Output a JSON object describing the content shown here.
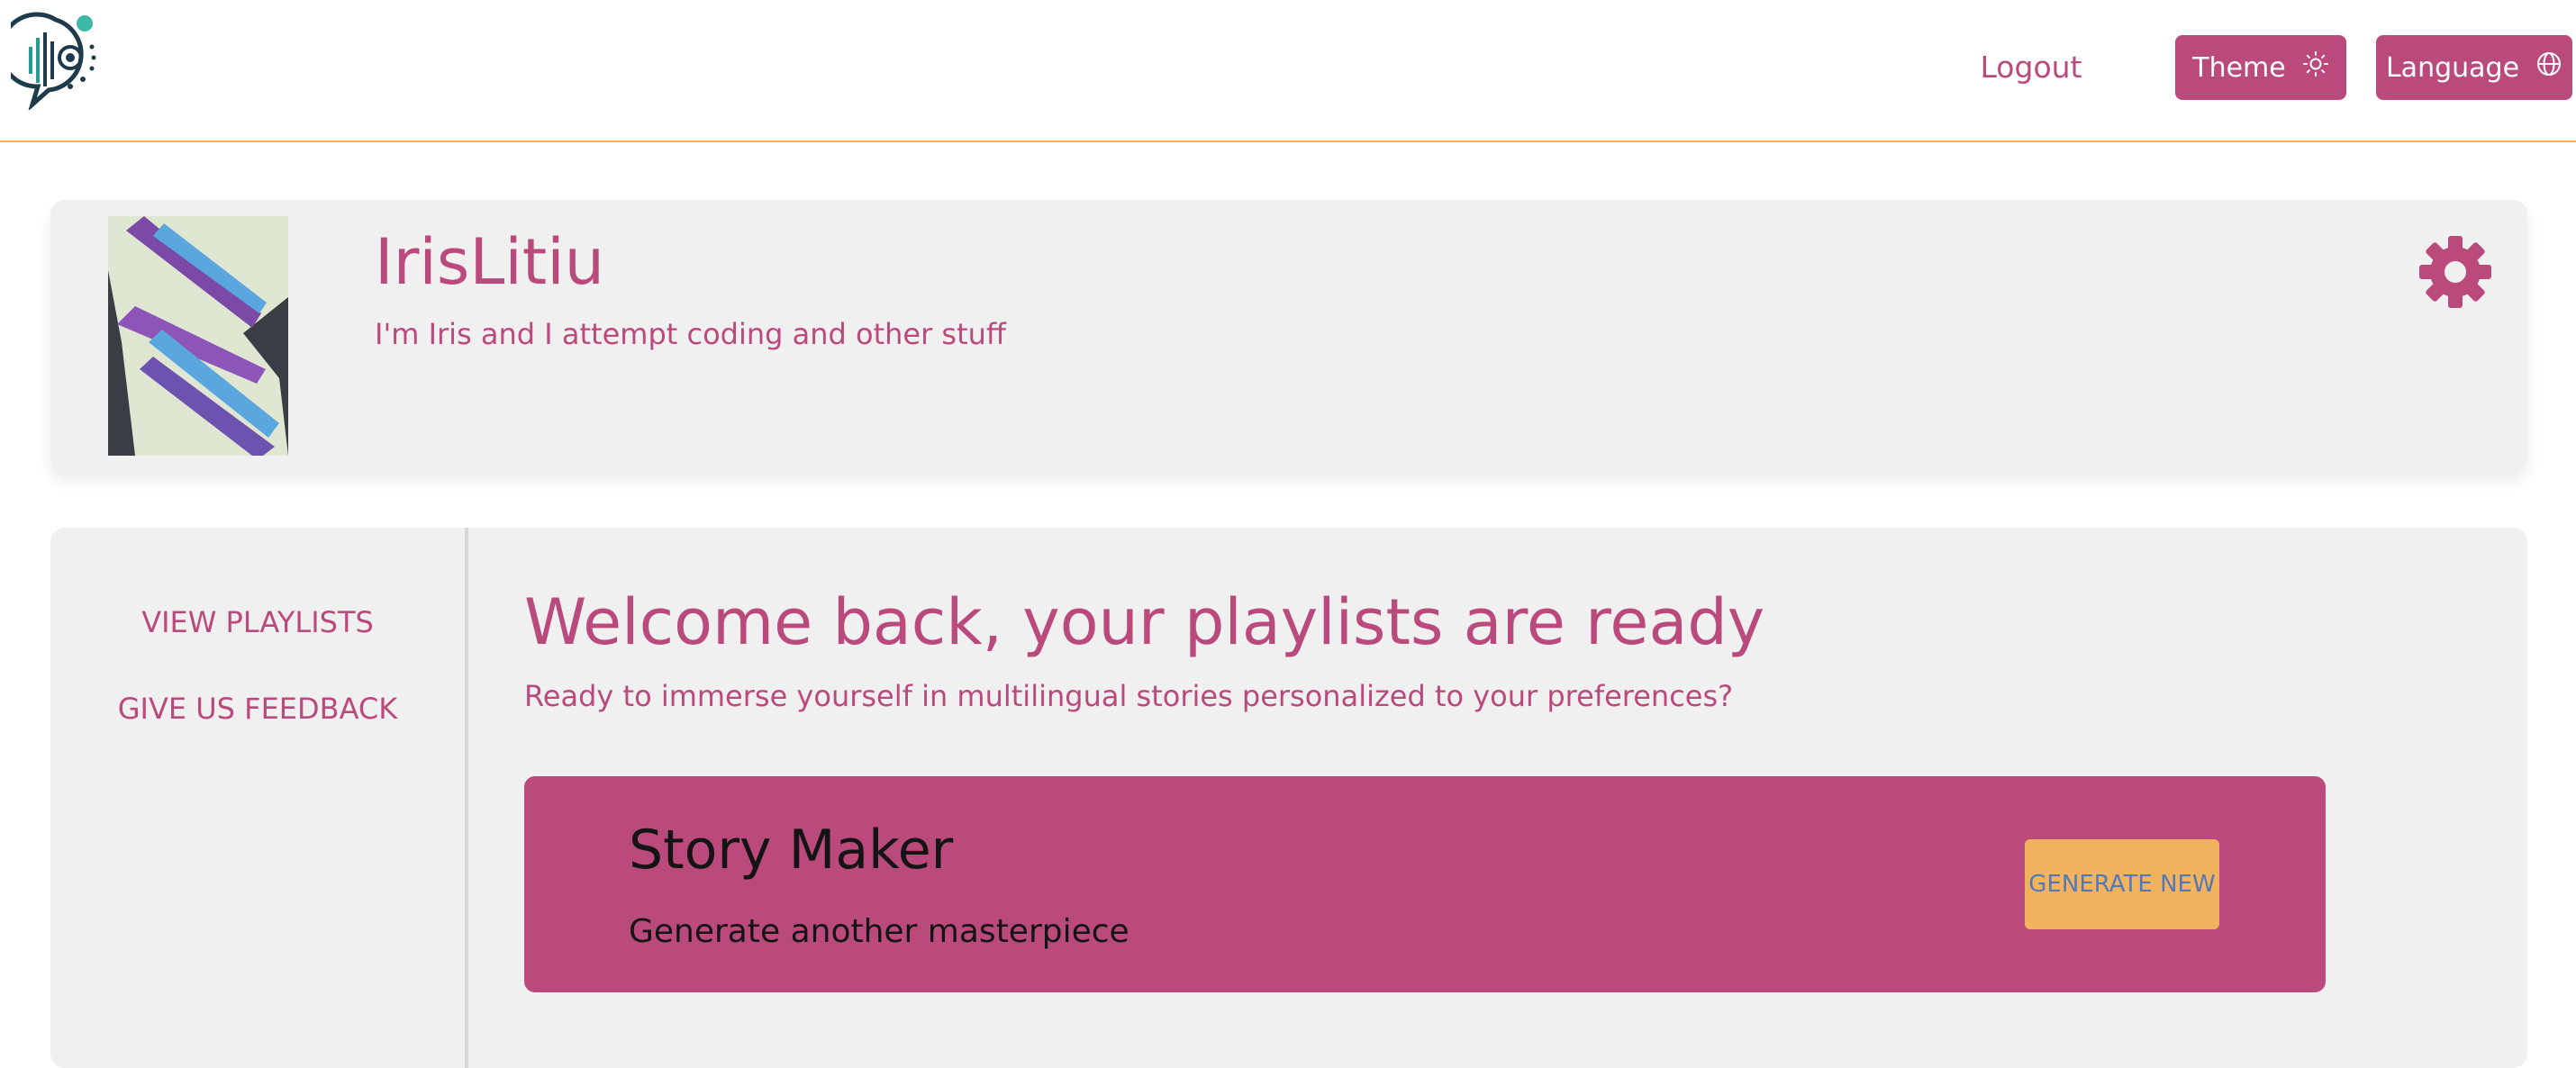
{
  "header": {
    "logout_label": "Logout",
    "theme_label": "Theme",
    "language_label": "Language",
    "logo_icon": "speech-bubble-soundwave-logo",
    "theme_icon": "sun-icon",
    "language_icon": "globe-icon"
  },
  "profile": {
    "username": "IrisLitiu",
    "bio": "I'm Iris and I attempt coding and other stuff",
    "settings_icon": "gear-icon"
  },
  "sidebar": {
    "items": [
      {
        "label": "VIEW PLAYLISTS"
      },
      {
        "label": "GIVE US FEEDBACK"
      }
    ]
  },
  "main": {
    "welcome_title": "Welcome back, your playlists are ready",
    "welcome_subtitle": "Ready to immerse yourself in multilingual stories personalized to your preferences?",
    "story_card": {
      "title": "Story Maker",
      "description": "Generate another masterpiece",
      "button_label": "GENERATE NEW"
    }
  },
  "colors": {
    "accent": "#bb4a7c",
    "secondary": "#f1b35e",
    "panel_bg": "#f0f0f0",
    "button_text_blue": "#5478b6"
  }
}
